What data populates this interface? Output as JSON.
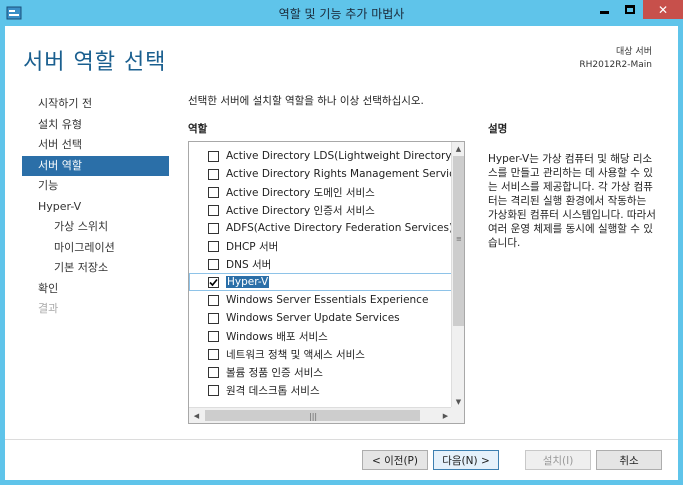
{
  "window": {
    "title": "역할 및 기능 추가 마법사",
    "minimize_icon": "minimize-icon",
    "maximize_icon": "maximize-icon",
    "close_icon": "close-icon"
  },
  "header": {
    "title": "서버 역할 선택",
    "target_label": "대상 서버",
    "target_server": "RH2012R2-Main"
  },
  "nav": {
    "items": [
      {
        "label": "시작하기 전",
        "level": 0,
        "state": "normal"
      },
      {
        "label": "설치 유형",
        "level": 0,
        "state": "normal"
      },
      {
        "label": "서버 선택",
        "level": 0,
        "state": "normal"
      },
      {
        "label": "서버 역할",
        "level": 0,
        "state": "active"
      },
      {
        "label": "기능",
        "level": 0,
        "state": "normal"
      },
      {
        "label": "Hyper-V",
        "level": 0,
        "state": "normal"
      },
      {
        "label": "가상 스위치",
        "level": 1,
        "state": "normal"
      },
      {
        "label": "마이그레이션",
        "level": 1,
        "state": "normal"
      },
      {
        "label": "기본 저장소",
        "level": 1,
        "state": "normal"
      },
      {
        "label": "확인",
        "level": 0,
        "state": "normal"
      },
      {
        "label": "결과",
        "level": 0,
        "state": "disabled"
      }
    ]
  },
  "main": {
    "instruction": "선택한 서버에 설치할 역할을 하나 이상 선택하십시오.",
    "roles_header": "역할",
    "description_header": "설명",
    "roles": [
      {
        "label": "Active Directory LDS(Lightweight Directory Servi",
        "checked": false
      },
      {
        "label": "Active Directory Rights Management Services",
        "checked": false
      },
      {
        "label": "Active Directory 도메인 서비스",
        "checked": false
      },
      {
        "label": "Active Directory 인증서 서비스",
        "checked": false
      },
      {
        "label": "ADFS(Active Directory Federation Services)",
        "checked": false
      },
      {
        "label": "DHCP 서버",
        "checked": false
      },
      {
        "label": "DNS 서버",
        "checked": false
      },
      {
        "label": "Hyper-V",
        "checked": true,
        "selected": true
      },
      {
        "label": "Windows Server Essentials Experience",
        "checked": false
      },
      {
        "label": "Windows Server Update Services",
        "checked": false
      },
      {
        "label": "Windows 배포 서비스",
        "checked": false
      },
      {
        "label": "네트워크 정책 및 액세스 서비스",
        "checked": false
      },
      {
        "label": "볼륨 정품 인증 서비스",
        "checked": false
      },
      {
        "label": "원격 데스크톱 서비스",
        "checked": false
      }
    ],
    "description": "Hyper-V는 가상 컴퓨터 및 해당 리소스를 만들고 관리하는 데 사용할 수 있는 서비스를 제공합니다. 각 가상 컴퓨터는 격리된 실행 환경에서 작동하는 가상화된 컴퓨터 시스템입니다. 따라서 여러 운영 체제를 동시에 실행할 수 있습니다."
  },
  "footer": {
    "prev_label": "< 이전(P)",
    "next_label": "다음(N) >",
    "install_label": "설치(I)",
    "cancel_label": "취소"
  },
  "colors": {
    "titlebar": "#5fc4ea",
    "close": "#c7504b",
    "accent": "#2b6fa8",
    "title_text": "#1a5f8f"
  }
}
